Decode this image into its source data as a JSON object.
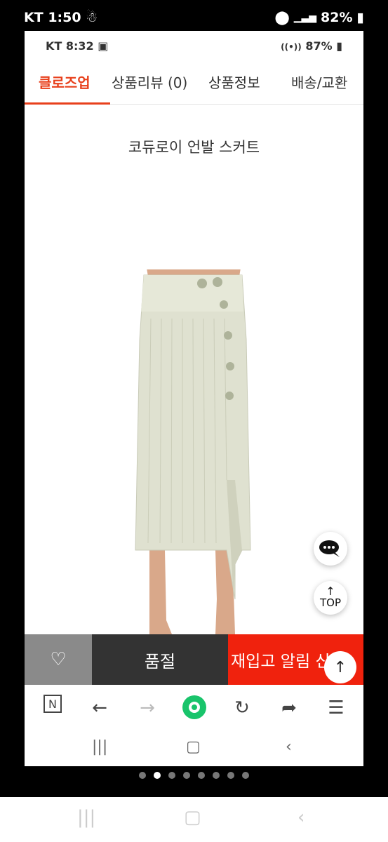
{
  "outer_status": {
    "carrier": "KT",
    "time": "1:50",
    "battery": "82%"
  },
  "inner_status": {
    "carrier": "KT",
    "time": "8:32",
    "battery": "87%"
  },
  "tabs": [
    {
      "label": "클로즈업",
      "active": true
    },
    {
      "label": "상품리뷰 (0)",
      "active": false
    },
    {
      "label": "상품정보",
      "active": false
    },
    {
      "label": "배송/교환",
      "active": false
    }
  ],
  "product": {
    "title": "코듀로이 언발 스커트",
    "image_icon": "skirt-product-image"
  },
  "floating": {
    "top_label": "TOP",
    "chat_icon": "chat-bubble-icon"
  },
  "actions": {
    "soldout_label": "품절",
    "restock_label": "재입고 알림 신청"
  },
  "colors": {
    "accent": "#e8401c",
    "restock": "#f0220d",
    "soldout": "#333333",
    "wish": "#8a8a8a",
    "naver_green": "#19c46b"
  },
  "pager": {
    "count": 8,
    "active_index": 1
  }
}
